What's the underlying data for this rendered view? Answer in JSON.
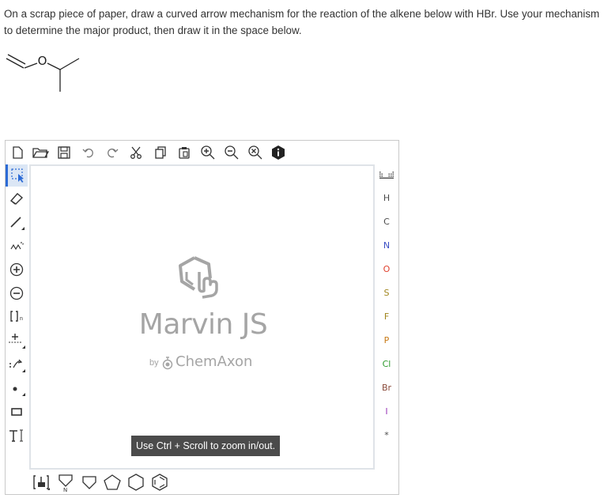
{
  "question": {
    "text": "On a scrap piece of paper, draw a curved arrow mechanism for the reaction of the alkene below with HBr. Use your mechanism to determine the major product, then draw it in the space below."
  },
  "molecule": {
    "atom_label": "O"
  },
  "editor": {
    "top_toolbar": [
      {
        "name": "new-document-icon"
      },
      {
        "name": "open-folder-icon"
      },
      {
        "name": "save-icon"
      },
      {
        "name": "undo-icon"
      },
      {
        "name": "redo-icon"
      },
      {
        "name": "cut-icon"
      },
      {
        "name": "copy-icon"
      },
      {
        "name": "paste-icon"
      },
      {
        "name": "zoom-in-icon"
      },
      {
        "name": "zoom-out-icon"
      },
      {
        "name": "zoom-reset-icon"
      },
      {
        "name": "info-icon"
      }
    ],
    "left_toolbar": [
      "rectangle-select-icon",
      "eraser-icon",
      "single-bond-icon",
      "chain-icon",
      "positive-charge-icon",
      "negative-charge-icon",
      "sgroup-bracket-icon",
      "reaction-arrow-icon",
      "electron-flow-arrow-icon",
      "radical-dot-icon",
      "shape-rectangle-icon",
      "text-tool-icon"
    ],
    "sgroup_subscript": "n",
    "elements": [
      {
        "symbol": "H",
        "color": "#4a4a4a"
      },
      {
        "symbol": "C",
        "color": "#4a4a4a"
      },
      {
        "symbol": "N",
        "color": "#3b4ec4"
      },
      {
        "symbol": "O",
        "color": "#e0412e"
      },
      {
        "symbol": "S",
        "color": "#a0851c"
      },
      {
        "symbol": "F",
        "color": "#a0851c"
      },
      {
        "symbol": "P",
        "color": "#c87a16"
      },
      {
        "symbol": "Cl",
        "color": "#2c9a2c"
      },
      {
        "symbol": "Br",
        "color": "#8a4a3a"
      },
      {
        "symbol": "I",
        "color": "#9a3ab8"
      },
      {
        "symbol": "*",
        "color": "#4a4a4a"
      }
    ],
    "bottom_toolbar": [
      "template-library-icon",
      "cyclopropane-icon",
      "cyclobutane-icon",
      "cyclopentane-icon",
      "cyclohexane-icon",
      "benzene-icon"
    ],
    "template_label": "N",
    "logo": {
      "title": "Marvin JS",
      "by": "by",
      "company": "ChemAxon"
    },
    "hint": "Use Ctrl + Scroll to zoom in/out."
  }
}
